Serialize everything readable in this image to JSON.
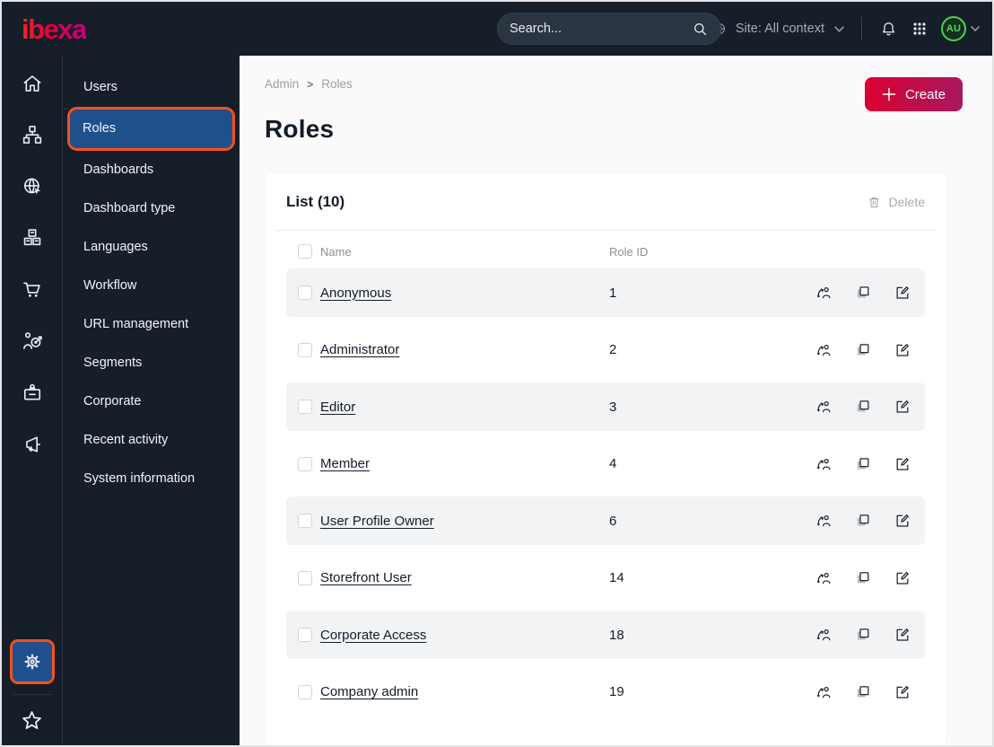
{
  "topbar": {
    "logo_text": "ibexa",
    "search": {
      "placeholder": "Search..."
    },
    "site_context": {
      "label": "Site: All context"
    },
    "avatar": {
      "initials": "AU"
    }
  },
  "sidebar": {
    "icons": [
      "home-icon",
      "sitemap-icon",
      "globe-cursor-icon",
      "boxes-icon",
      "cart-icon",
      "person-target-icon",
      "badge-icon",
      "megaphone-icon"
    ],
    "bottom_icons": [
      "gear-icon",
      "star-icon"
    ],
    "highlighted": "gear-icon"
  },
  "menu": {
    "items": [
      {
        "label": "Users",
        "selected": false
      },
      {
        "label": "Roles",
        "selected": true
      },
      {
        "label": "Dashboards",
        "selected": false
      },
      {
        "label": "Dashboard type",
        "selected": false
      },
      {
        "label": "Languages",
        "selected": false
      },
      {
        "label": "Workflow",
        "selected": false
      },
      {
        "label": "URL management",
        "selected": false
      },
      {
        "label": "Segments",
        "selected": false
      },
      {
        "label": "Corporate",
        "selected": false
      },
      {
        "label": "Recent activity",
        "selected": false
      },
      {
        "label": "System information",
        "selected": false
      }
    ]
  },
  "breadcrumb": {
    "parent": "Admin",
    "separator": ">",
    "current": "Roles"
  },
  "page": {
    "title": "Roles",
    "create_button": "Create"
  },
  "list_card": {
    "title": "List (10)",
    "delete_button": "Delete",
    "columns": {
      "name": "Name",
      "role_id": "Role ID"
    },
    "row_actions": [
      "assign-user",
      "copy",
      "edit"
    ],
    "rows": [
      {
        "name": "Anonymous",
        "role_id": "1"
      },
      {
        "name": "Administrator",
        "role_id": "2"
      },
      {
        "name": "Editor",
        "role_id": "3"
      },
      {
        "name": "Member",
        "role_id": "4"
      },
      {
        "name": "User Profile Owner",
        "role_id": "6"
      },
      {
        "name": "Storefront User",
        "role_id": "14"
      },
      {
        "name": "Corporate Access",
        "role_id": "18"
      },
      {
        "name": "Company admin",
        "role_id": "19"
      }
    ]
  },
  "colors": {
    "topbar_bg": "#151e29",
    "annotation_orange": "#f4501d",
    "selected_blue": "#20508c",
    "create_gradient_start": "#dc0032",
    "create_gradient_end": "#a51a60",
    "avatar_green": "#4ed153",
    "row_stripe": "#f2f3f5",
    "text_dark": "#131c28"
  }
}
